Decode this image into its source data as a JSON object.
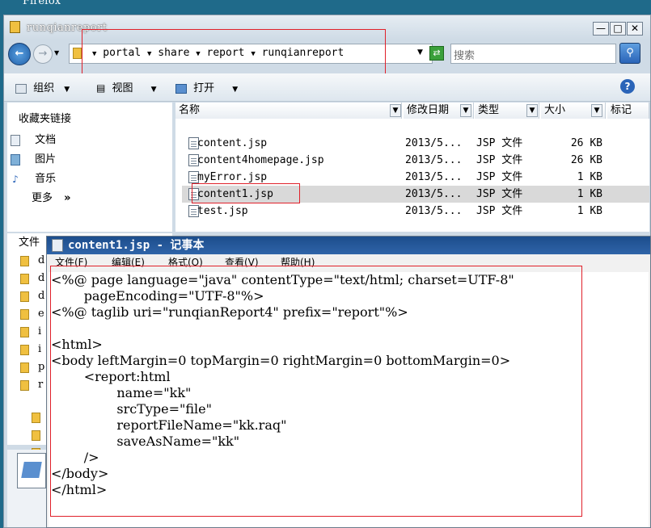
{
  "taskbar_label": "Firefox",
  "explorer": {
    "title": "runqianreport",
    "breadcrumb": [
      "portal",
      "share",
      "report",
      "runqianreport"
    ],
    "search_placeholder": "搜索",
    "toolbar": {
      "organize": "组织",
      "view": "视图",
      "open": "打开"
    },
    "nav_favorites_header": "收藏夹链接",
    "nav_items": [
      "文档",
      "图片",
      "音乐",
      "更多"
    ],
    "nav_more_chevron": "»",
    "folders_header": "文件",
    "folder_letters": [
      "d",
      "d",
      "d",
      "e",
      "i",
      "i",
      "p",
      "r"
    ],
    "columns": [
      "名称",
      "修改日期",
      "类型",
      "大小",
      "标记"
    ],
    "files": [
      {
        "name": "content.jsp",
        "date": "2013/5...",
        "type": "JSP 文件",
        "size": "26 KB"
      },
      {
        "name": "content4homepage.jsp",
        "date": "2013/5...",
        "type": "JSP 文件",
        "size": "26 KB"
      },
      {
        "name": "myError.jsp",
        "date": "2013/5...",
        "type": "JSP 文件",
        "size": "1 KB"
      },
      {
        "name": "content1.jsp",
        "date": "2013/5...",
        "type": "JSP 文件",
        "size": "1 KB",
        "selected": true
      },
      {
        "name": "test.jsp",
        "date": "2013/5...",
        "type": "JSP 文件",
        "size": "1 KB"
      }
    ]
  },
  "notepad": {
    "title": "content1.jsp - 记事本",
    "menu": [
      "文件(F)",
      "编辑(E)",
      "格式(O)",
      "查看(V)",
      "帮助(H)"
    ],
    "lines": [
      "<%@ page language=\"java\" contentType=\"text/html; charset=UTF-8\"",
      "        pageEncoding=\"UTF-8\"%>",
      "<%@ taglib uri=\"runqianReport4\" prefix=\"report\"%>",
      "",
      "<html>",
      "<body leftMargin=0 topMargin=0 rightMargin=0 bottomMargin=0>",
      "        <report:html",
      "                name=\"kk\"",
      "                srcType=\"file\"",
      "                reportFileName=\"kk.raq\"",
      "                saveAsName=\"kk\"",
      "        />",
      "</body>",
      "</html>"
    ]
  },
  "colors": {
    "desktop": "#1f6a8a",
    "highlight": "#e0202a",
    "notepad_title": "#2f64a8"
  }
}
